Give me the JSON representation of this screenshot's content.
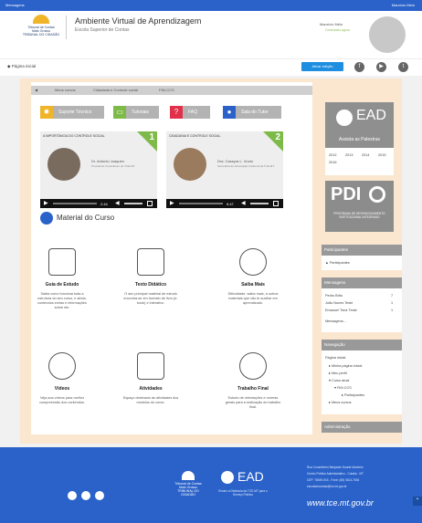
{
  "topbar": {
    "messages": "Mensagens",
    "user": "Maurício Melo"
  },
  "header": {
    "logo_text": [
      "Tribunal de Contas",
      "Mato Grosso",
      "TRIBUNAL DO CIDADÃO"
    ],
    "title": "Ambiente Virtual de Aprendizagem",
    "subtitle": "Escola Superior de Contas",
    "user_name": "Maurício Melo",
    "user_status": "Conectado agora"
  },
  "subbar": {
    "home": "Página inicial",
    "ativar": "Ativar edição"
  },
  "breadcrumb": [
    "Meus cursos",
    "Cidadania e Controle social",
    "FIM-CCS"
  ],
  "quick_buttons": [
    {
      "label": "Suporte Técnico",
      "icon": "gear-icon",
      "color": "#f0b429"
    },
    {
      "label": "Tutoriais",
      "icon": "book-icon",
      "color": "#7dba47"
    },
    {
      "label": "FAQ",
      "icon": "question-icon",
      "color": "#e0304a"
    },
    {
      "label": "Sala do Tutor",
      "icon": "user-icon",
      "color": "#2a62c9"
    }
  ],
  "videos": [
    {
      "title": "A IMPORTÂNCIA DO CONTROLE SOCIAL",
      "number": "1",
      "name": "Dr. Antonio Joaquim",
      "role": "Presidente Conselheiro do TCE-MT",
      "time": "2:44"
    },
    {
      "title": "CIDADANIA E CONTROLE SOCIAL",
      "number": "2",
      "name": "Dra. Cassyra L. Vuolo",
      "role": "Secretária de Articulação Institucional TCE-MT",
      "time": "5:47"
    }
  ],
  "material": {
    "title": "Material do Curso",
    "items": [
      {
        "title": "Guia de Estudo",
        "desc": "Saiba como funciona toda a estrutura do seu curso, e ainda, conteúdos extras e informações sobre ele.",
        "icon": "guide-icon"
      },
      {
        "title": "Texto Didático",
        "desc": "O seu principal material de estudo encontra-se em formato de livro (e-book) e interativo.",
        "icon": "document-icon"
      },
      {
        "title": "Saiba Mais",
        "desc": "Dificuldade, saiba mais, a outros materiais que vão te auxiliar em aprendizado.",
        "icon": "search-icon"
      },
      {
        "title": "Vídeos",
        "desc": "Veja aos vídeos para melhor compreensão dos conteúdos.",
        "icon": "play-icon"
      },
      {
        "title": "Atividades",
        "desc": "Espaço destinado às atividades dos módulos do curso.",
        "icon": "pencil-icon"
      },
      {
        "title": "Trabalho Final",
        "desc": "Estudo de orientações e normas gerais para a realização do trabalho final.",
        "icon": "certificate-icon"
      }
    ]
  },
  "sidebar": {
    "ead_label": "EAD",
    "ead_caption": "Assista as Palestras",
    "years": [
      "2012",
      "2013",
      "2014",
      "2015",
      "2016"
    ],
    "pdi_label": "PDI",
    "pdi_caption": "PROGRAMA DE DESENVOLVIMENTO INSTITUCIONAL INTEGRADO",
    "participants_head": "Participantes",
    "participants_link": "Participantes",
    "messages_head": "Mensagens",
    "messages": [
      {
        "name": "Pedro Brito",
        "count": "7"
      },
      {
        "name": "João Nunes Teste",
        "count": "1"
      },
      {
        "name": "Emanuel Tutor Teste",
        "count": "1"
      }
    ],
    "messages_link": "Mensagens...",
    "nav_head": "Navegação",
    "nav_items": [
      "Página inicial",
      "Minha página inicial",
      "Meu perfil",
      "Curso atual",
      "FIM-CCS",
      "Participantes",
      "Meus cursos"
    ],
    "admin_head": "Administração"
  },
  "footer": {
    "address": [
      "Rua Conselheiro Benjamin Duarte Monteiro",
      "Centro Político Administrativo - Cuiabá - MT",
      "CEP: 78049-915 - Fone: (65) 3613-7654",
      "escoladecontas@tce.mt.gov.br"
    ],
    "logo_text": [
      "Tribunal de Contas",
      "Mato Grosso",
      "TRIBUNAL DO CIDADÃO"
    ],
    "ead_caption": "Ensino a Distância da TCE-MT para o Serviço Público",
    "ead_label": "EAD",
    "site": "www.tce.mt.gov.br"
  }
}
